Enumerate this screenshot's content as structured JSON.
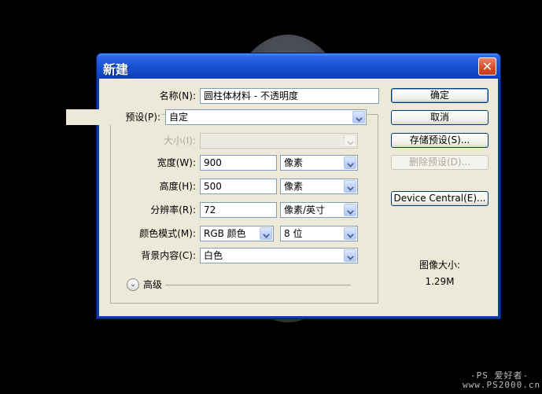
{
  "dialog": {
    "title": "新建",
    "close_glyph": "✕"
  },
  "form": {
    "name": {
      "label": "名称(N):",
      "value": "圆柱体材料 - 不透明度"
    },
    "preset": {
      "label": "预设(P):",
      "value": "自定"
    },
    "size": {
      "label": "大小(I):",
      "value": ""
    },
    "width": {
      "label": "宽度(W):",
      "value": "900",
      "unit": "像素"
    },
    "height": {
      "label": "高度(H):",
      "value": "500",
      "unit": "像素"
    },
    "resolution": {
      "label": "分辨率(R):",
      "value": "72",
      "unit": "像素/英寸"
    },
    "color_mode": {
      "label": "颜色模式(M):",
      "value": "RGB 颜色",
      "depth": "8 位"
    },
    "background": {
      "label": "背景内容(C):",
      "value": "白色"
    },
    "advanced": {
      "label": "高级",
      "glyph": "⌄"
    }
  },
  "buttons": {
    "ok": "确定",
    "cancel": "取消",
    "save_preset": "存储预设(S)...",
    "delete_preset": "删除预设(D)...",
    "device_central": "Device Central(E)..."
  },
  "image_size": {
    "label": "图像大小:",
    "value": "1.29M"
  },
  "watermark": {
    "line1": "-PS 爱好者-",
    "line2": "www.PS2000.cn"
  },
  "colors": {
    "titlebar": "#1b56d6",
    "client_bg": "#ece9d8",
    "close_button": "#d9522f"
  }
}
